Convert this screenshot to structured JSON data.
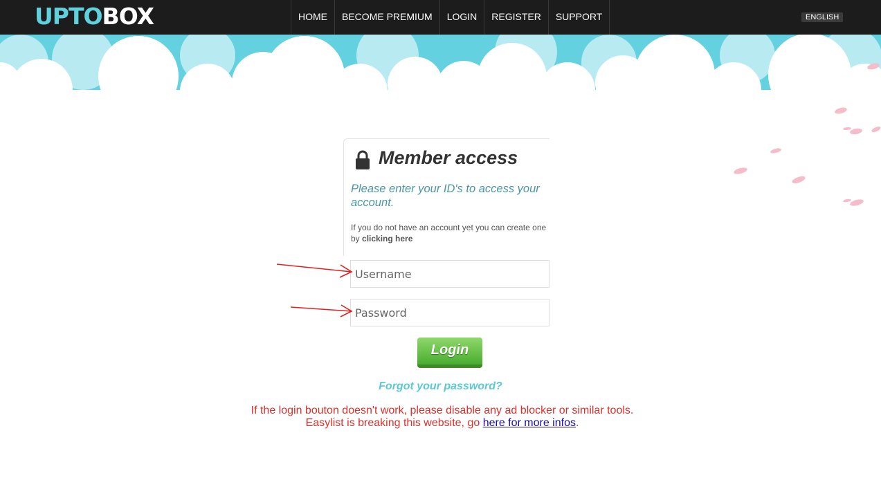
{
  "header": {
    "logo_left": "UPTO",
    "logo_right": "BOX",
    "nav": [
      "HOME",
      "BECOME PREMIUM",
      "LOGIN",
      "REGISTER",
      "SUPPORT"
    ],
    "language": "ENGLISH"
  },
  "login": {
    "title": "Member access",
    "intro": "Please enter your ID's to access your account.",
    "note_prefix": "If you do not have an account yet you can create one by",
    "note_link": "clicking here",
    "username_placeholder": "Username",
    "password_placeholder": "Password",
    "login_button": "Login",
    "forgot": "Forgot your password?"
  },
  "warning": {
    "line1": "If the login bouton doesn't work, please disable any ad blocker or similar tools.",
    "line2_prefix": "Easylist is breaking this website, go",
    "link": "here for more infos",
    "suffix": "."
  },
  "colors": {
    "topbar": "#1c1c1c",
    "logo_accent": "#5fd0de",
    "sky": "#63d1df",
    "warning": "#d9302b",
    "button": "#49ad30",
    "arrow": "#e02020"
  }
}
